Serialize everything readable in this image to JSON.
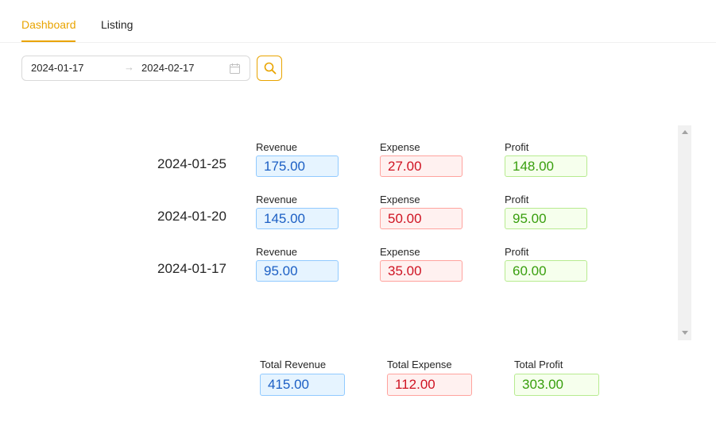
{
  "tabs": [
    {
      "label": "Dashboard",
      "active": true
    },
    {
      "label": "Listing",
      "active": false
    }
  ],
  "date_range": {
    "start": "2024-01-17",
    "separator": "→",
    "end": "2024-02-17"
  },
  "labels": {
    "revenue": "Revenue",
    "expense": "Expense",
    "profit": "Profit"
  },
  "rows": [
    {
      "date": "2024-01-25",
      "revenue": "175.00",
      "expense": "27.00",
      "profit": "148.00"
    },
    {
      "date": "2024-01-20",
      "revenue": "145.00",
      "expense": "50.00",
      "profit": "95.00"
    },
    {
      "date": "2024-01-17",
      "revenue": "95.00",
      "expense": "35.00",
      "profit": "60.00"
    }
  ],
  "totals": {
    "revenue_label": "Total Revenue",
    "revenue": "415.00",
    "expense_label": "Total Expense",
    "expense": "112.00",
    "profit_label": "Total Profit",
    "profit": "303.00"
  },
  "colors": {
    "accent": "#e9a400",
    "revenue_bg": "#e6f4ff",
    "revenue_text": "#1c5fc4",
    "expense_bg": "#fff1f0",
    "expense_text": "#cf1322",
    "profit_bg": "#f6ffed",
    "profit_text": "#389e0d"
  },
  "icons": {
    "calendar": "calendar-icon",
    "search": "search-icon"
  }
}
